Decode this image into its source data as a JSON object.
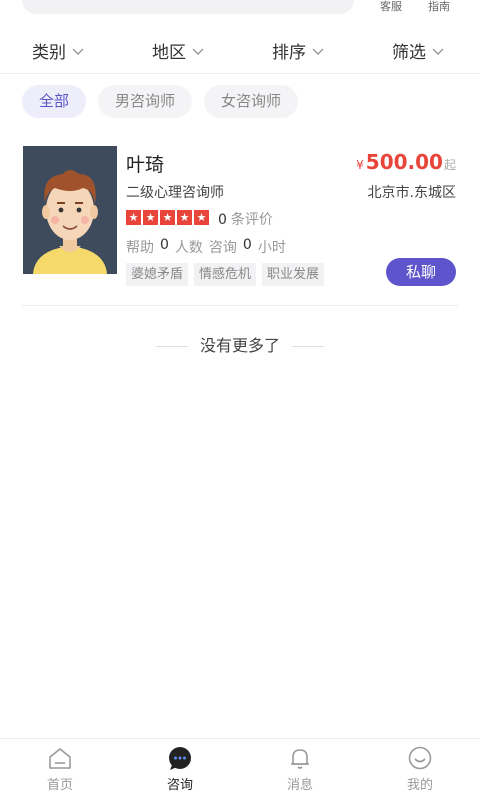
{
  "top": {
    "service": "客服",
    "guide": "指南"
  },
  "filters": {
    "category": "类别",
    "region": "地区",
    "sort": "排序",
    "filter": "筛选"
  },
  "chips": {
    "all": "全部",
    "male": "男咨询师",
    "female": "女咨询师"
  },
  "counselor": {
    "name": "叶琦",
    "currency": "¥",
    "price": "500.00",
    "price_suffix": "起",
    "title": "二级心理咨询师",
    "location": "北京市.东城区",
    "rating_stars": 5,
    "review_count": "0",
    "review_label": "条评价",
    "help_label": "帮助",
    "help_count": "0",
    "people_label": "人数",
    "consult_label": "咨询",
    "consult_count": "0",
    "hours_label": "小时",
    "tags": [
      "婆媳矛盾",
      "情感危机",
      "职业发展"
    ],
    "chat_button": "私聊"
  },
  "no_more": "没有更多了",
  "tabbar": {
    "home": "首页",
    "consult": "咨询",
    "message": "消息",
    "mine": "我的"
  },
  "colors": {
    "accent": "#5e55cc",
    "price": "#e8443a"
  }
}
